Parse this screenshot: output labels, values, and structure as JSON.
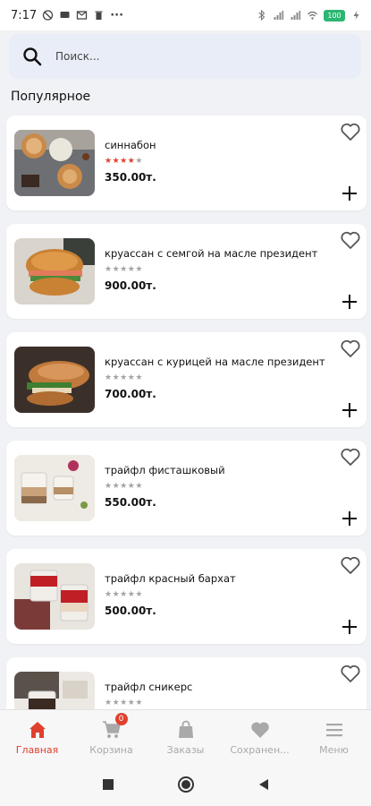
{
  "status_bar": {
    "time": "7:17",
    "dots": "···",
    "battery_level": "100"
  },
  "search": {
    "placeholder": "Поиск..."
  },
  "section": {
    "title": "Популярное"
  },
  "products": [
    {
      "name": "синнабон",
      "rating": 4,
      "price": "350.00т."
    },
    {
      "name": "круассан с семгой на масле президент",
      "rating": 0,
      "price": "900.00т."
    },
    {
      "name": "круассан с курицей на масле президент",
      "rating": 0,
      "price": "700.00т."
    },
    {
      "name": "трайфл фисташковый",
      "rating": 0,
      "price": "550.00т."
    },
    {
      "name": "трайфл красный бархат",
      "rating": 0,
      "price": "500.00т."
    },
    {
      "name": "трайфл сникерс",
      "rating": 0,
      "price": ""
    }
  ],
  "bottom_nav": {
    "items": [
      {
        "label": "Главная",
        "icon": "home-icon",
        "active": true
      },
      {
        "label": "Корзина",
        "icon": "cart-icon",
        "badge": "0"
      },
      {
        "label": "Заказы",
        "icon": "bag-icon"
      },
      {
        "label": "Сохранен...",
        "icon": "heart-icon"
      },
      {
        "label": "Меню",
        "icon": "menu-icon"
      }
    ]
  },
  "colors": {
    "accent": "#e0402e",
    "inactive": "#a9a9a9",
    "search_bg": "#e9edf7",
    "page_bg": "#f1f2f6"
  }
}
